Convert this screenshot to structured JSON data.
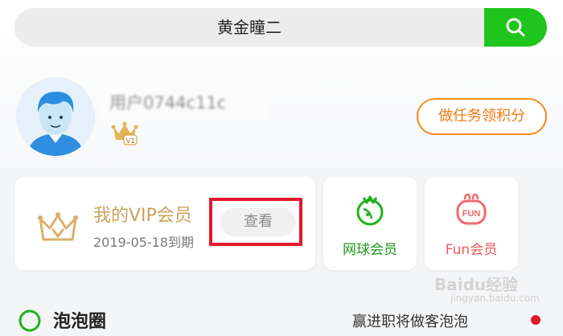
{
  "search": {
    "query": "黄金瞳二",
    "button_icon": "search-icon"
  },
  "profile": {
    "username": "用户0744c11c",
    "level_badge": "V1",
    "task_button": "做任务领积分"
  },
  "vip_card": {
    "title": "我的VIP会员",
    "expiry": "2019-05-18到期",
    "view_button": "查看"
  },
  "tennis_card": {
    "label": "网球会员",
    "icon": "tennis-icon"
  },
  "fun_card": {
    "label": "Fun会员",
    "icon": "fun-icon",
    "icon_text": "FUN"
  },
  "bubble": {
    "title": "泡泡圈",
    "hint": "赢进职将做客泡泡"
  },
  "watermark": {
    "brand": "Baidu经验",
    "url": "jingyan.baidu.com"
  },
  "colors": {
    "search_button": "#1fc41c",
    "task_button": "#f58a1f",
    "vip_gold": "#c9a15a",
    "highlight": "#e3182a"
  }
}
